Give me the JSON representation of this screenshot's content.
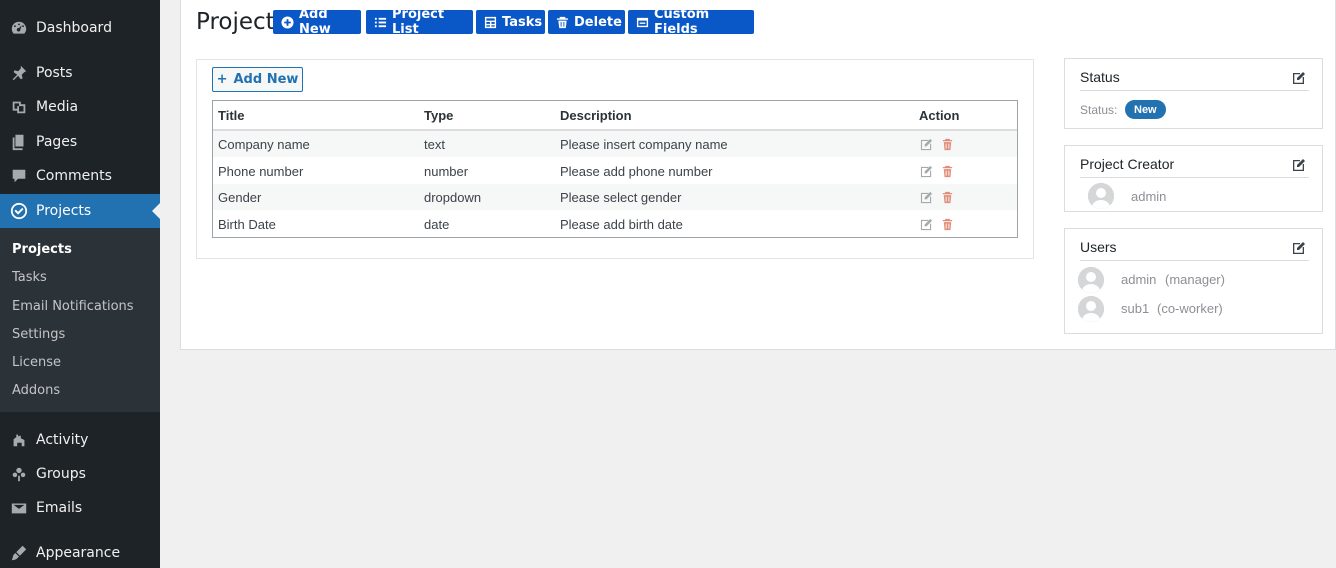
{
  "sidebar": {
    "items": [
      {
        "label": "Dashboard",
        "icon": "dashboard-icon"
      },
      {
        "label": "Posts",
        "icon": "pin-icon"
      },
      {
        "label": "Media",
        "icon": "media-icon"
      },
      {
        "label": "Pages",
        "icon": "pages-icon"
      },
      {
        "label": "Comments",
        "icon": "comment-icon"
      },
      {
        "label": "Projects",
        "icon": "check-circle-icon"
      },
      {
        "label": "Activity",
        "icon": "activity-icon"
      },
      {
        "label": "Groups",
        "icon": "groups-icon"
      },
      {
        "label": "Emails",
        "icon": "email-icon"
      },
      {
        "label": "Appearance",
        "icon": "brush-icon"
      }
    ],
    "submenu": [
      "Projects",
      "Tasks",
      "Email Notifications",
      "Settings",
      "License",
      "Addons"
    ]
  },
  "header": {
    "title": "Project",
    "buttons": [
      "Add New",
      "Project List",
      "Tasks",
      "Delete",
      "Custom Fields"
    ]
  },
  "fields": {
    "add_new_label": "Add New",
    "columns": [
      "Title",
      "Type",
      "Description",
      "Action"
    ],
    "rows": [
      {
        "title": "Company name",
        "type": "text",
        "description": "Please insert company name"
      },
      {
        "title": "Phone number",
        "type": "number",
        "description": "Please add phone number"
      },
      {
        "title": "Gender",
        "type": "dropdown",
        "description": "Please select gender"
      },
      {
        "title": "Birth Date",
        "type": "date",
        "description": "Please add birth date"
      }
    ]
  },
  "status_box": {
    "title": "Status",
    "label": "Status:",
    "badge": "New"
  },
  "creator_box": {
    "title": "Project Creator",
    "user": "admin"
  },
  "users_box": {
    "title": "Users",
    "users": [
      {
        "name": "admin",
        "role": "(manager)"
      },
      {
        "name": "sub1",
        "role": "(co-worker)"
      }
    ]
  },
  "colors": {
    "accent": "#2271b1",
    "button": "#0a57c8",
    "sidebar": "#1d2327",
    "delete": "#e08d7a"
  }
}
